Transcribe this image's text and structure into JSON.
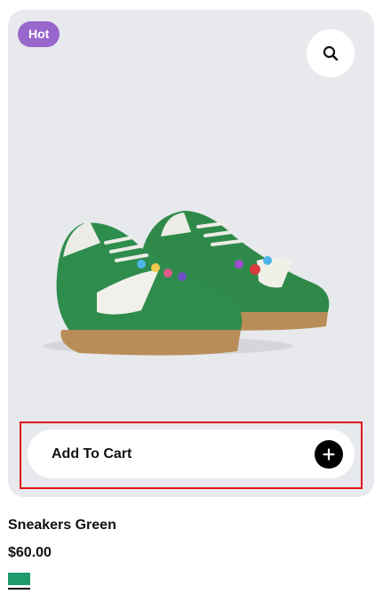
{
  "badge": {
    "label": "Hot",
    "color": "#9966cc"
  },
  "zoom": {
    "icon": "search-icon"
  },
  "cart": {
    "label": "Add To Cart",
    "icon": "plus-icon"
  },
  "product": {
    "title": "Sneakers Green",
    "price": "$60.00",
    "swatch_color": "#1f9a6b"
  }
}
